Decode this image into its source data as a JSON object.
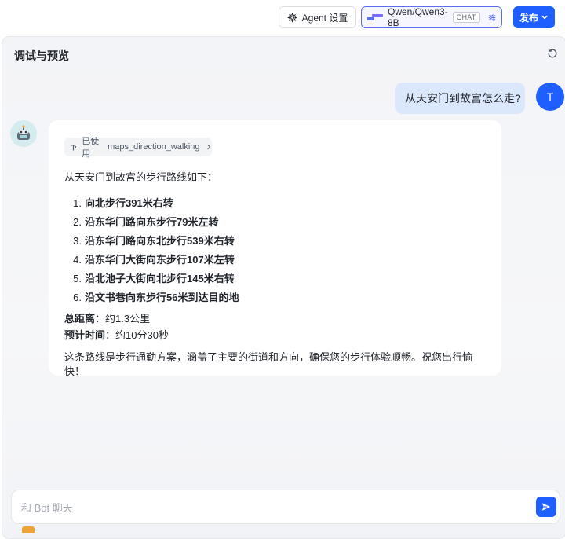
{
  "toolbar": {
    "agent_settings_label": "Agent 设置",
    "model_name": "Qwen/Qwen3-8B",
    "model_badge": "CHAT",
    "publish_label": "发布"
  },
  "panel": {
    "title": "调试与预览"
  },
  "conversation": {
    "user_message": "从天安门到故宫怎么走?",
    "user_avatar_letter": "T",
    "tool_used_prefix": "已使用",
    "tool_name": "maps_direction_walking",
    "intro": "从天安门到故宫的步行路线如下：",
    "steps": [
      {
        "num": "1.",
        "text": "向北步行391米右转"
      },
      {
        "num": "2.",
        "text": "沿东华门路向东步行79米左转"
      },
      {
        "num": "3.",
        "text": "沿东华门路向东北步行539米右转"
      },
      {
        "num": "4.",
        "text": "沿东华门大街向东步行107米左转"
      },
      {
        "num": "5.",
        "text": "沿北池子大街向北步行145米右转"
      },
      {
        "num": "6.",
        "text": "沿文书巷向东步行56米到达目的地"
      }
    ],
    "distance_label": "总距离",
    "distance_value": "：约1.3公里",
    "time_label": "预计时间",
    "time_value": "：约10分30秒",
    "closing": "这条路线是步行通勤方案，涵盖了主要的街道和方向，确保您的步行体验顺畅。祝您出行愉快！"
  },
  "input": {
    "placeholder": "和 Bot 聊天"
  },
  "colors": {
    "accent": "#1f5eff",
    "user_bubble": "#dbe7fb",
    "model_border": "#5b6cf0"
  },
  "icons": {
    "agent": "gear-icon",
    "model": "qwen-logo-icon",
    "tune": "sliders-icon",
    "publish": "chevron-down-icon",
    "refresh": "refresh-icon",
    "tool": "tool-icon",
    "tool_chevron": "chevron-right-icon",
    "send": "send-icon",
    "bot": "robot-icon"
  }
}
